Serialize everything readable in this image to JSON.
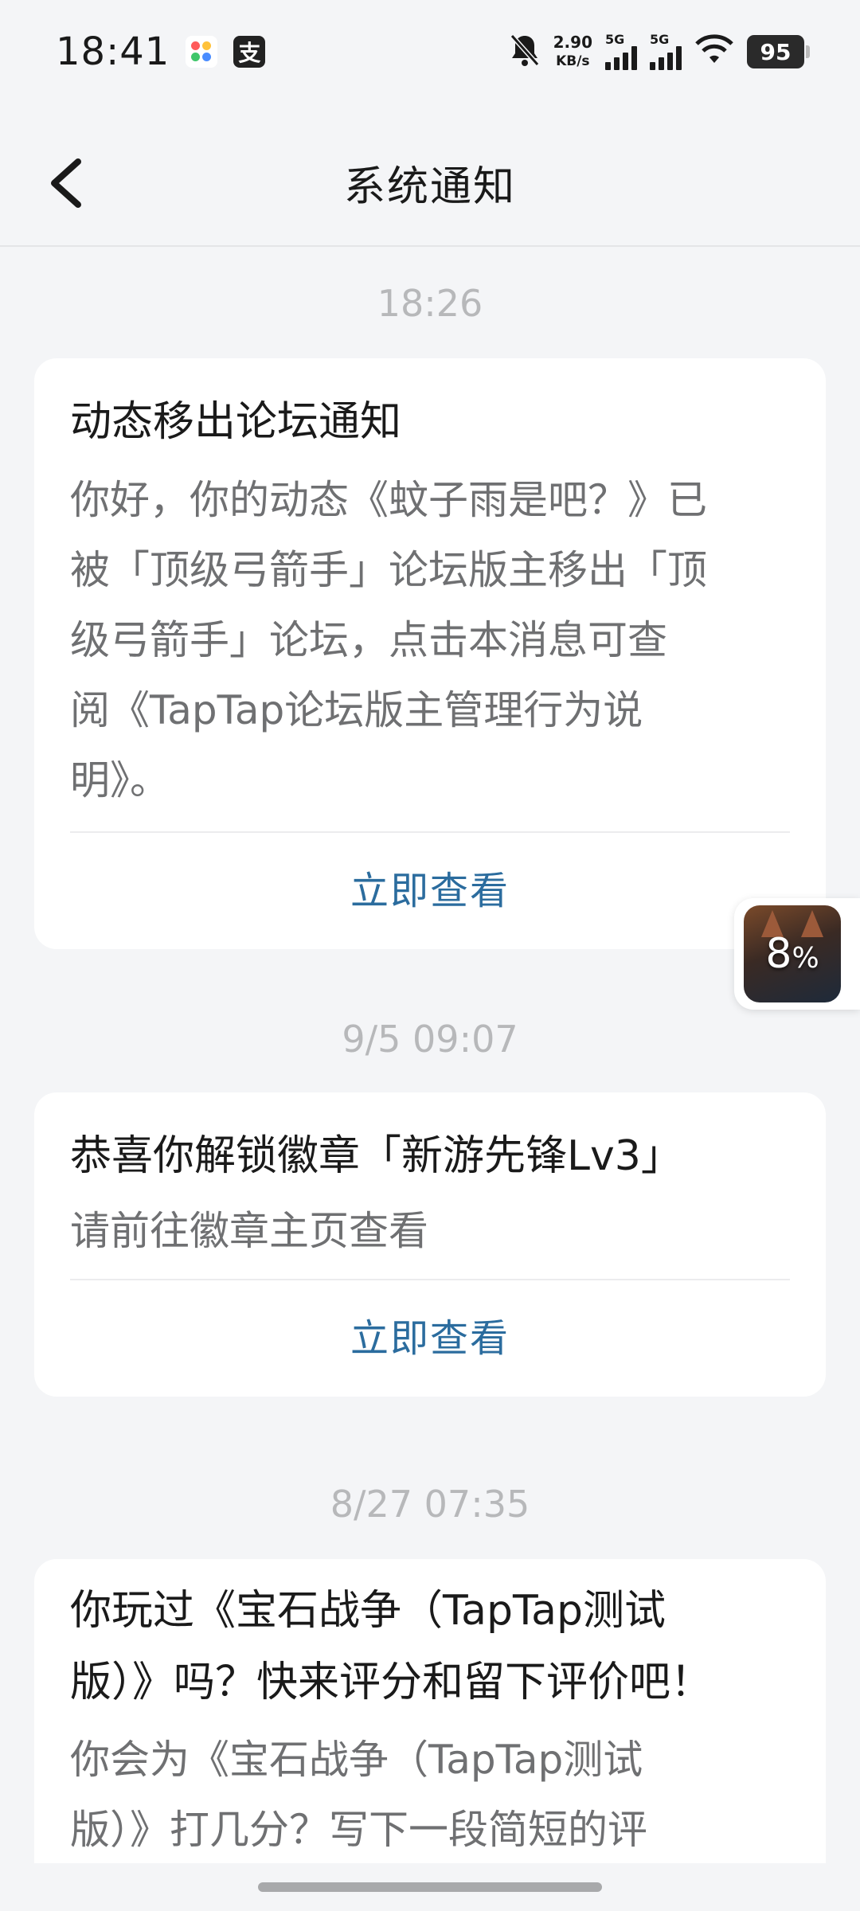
{
  "status_bar": {
    "time": "18:41",
    "net_speed_value": "2.90",
    "net_speed_unit": "KB/s",
    "sim1_label": "5G",
    "sim2_label": "5G",
    "battery": "95",
    "app_icon_2_glyph": "支",
    "icons": [
      "app-icon-colorful",
      "alipay-icon",
      "bell-muted-icon",
      "signal-icon",
      "signal-icon",
      "wifi-icon",
      "battery-icon"
    ]
  },
  "header": {
    "title": "系统通知",
    "back_icon": "chevron-left-icon"
  },
  "messages": [
    {
      "timestamp": "18:26",
      "title": "动态移出论坛通知",
      "body_lines": [
        "你好，你的动态《蚊子雨是吧？》已",
        "被「顶级弓箭手」论坛版主移出「顶",
        "级弓箭手」论坛，点击本消息可查",
        "阅《TapTap论坛版主管理行为说",
        "明》。"
      ],
      "action": "立即查看"
    },
    {
      "timestamp": "9/5  09:07",
      "title": "恭喜你解锁徽章「新游先锋Lv3」",
      "body_lines": [
        "请前往徽章主页查看"
      ],
      "action": "立即查看"
    },
    {
      "timestamp": "8/27  07:35",
      "title_lines": [
        "你玩过《宝石战争（TapTap测试",
        "版）》吗？快来评分和留下评价吧！"
      ],
      "body_lines": [
        "你会为《宝石战争（TapTap测试",
        "版）》打几分？写下一段简短的评"
      ]
    }
  ],
  "floating_widget": {
    "percent_value": "8",
    "percent_sign": "%"
  },
  "colors": {
    "background": "#f4f5f7",
    "card": "#ffffff",
    "action_link": "#2b6c9e",
    "timestamp": "#b7b8ba",
    "body_text": "#6f7072"
  }
}
